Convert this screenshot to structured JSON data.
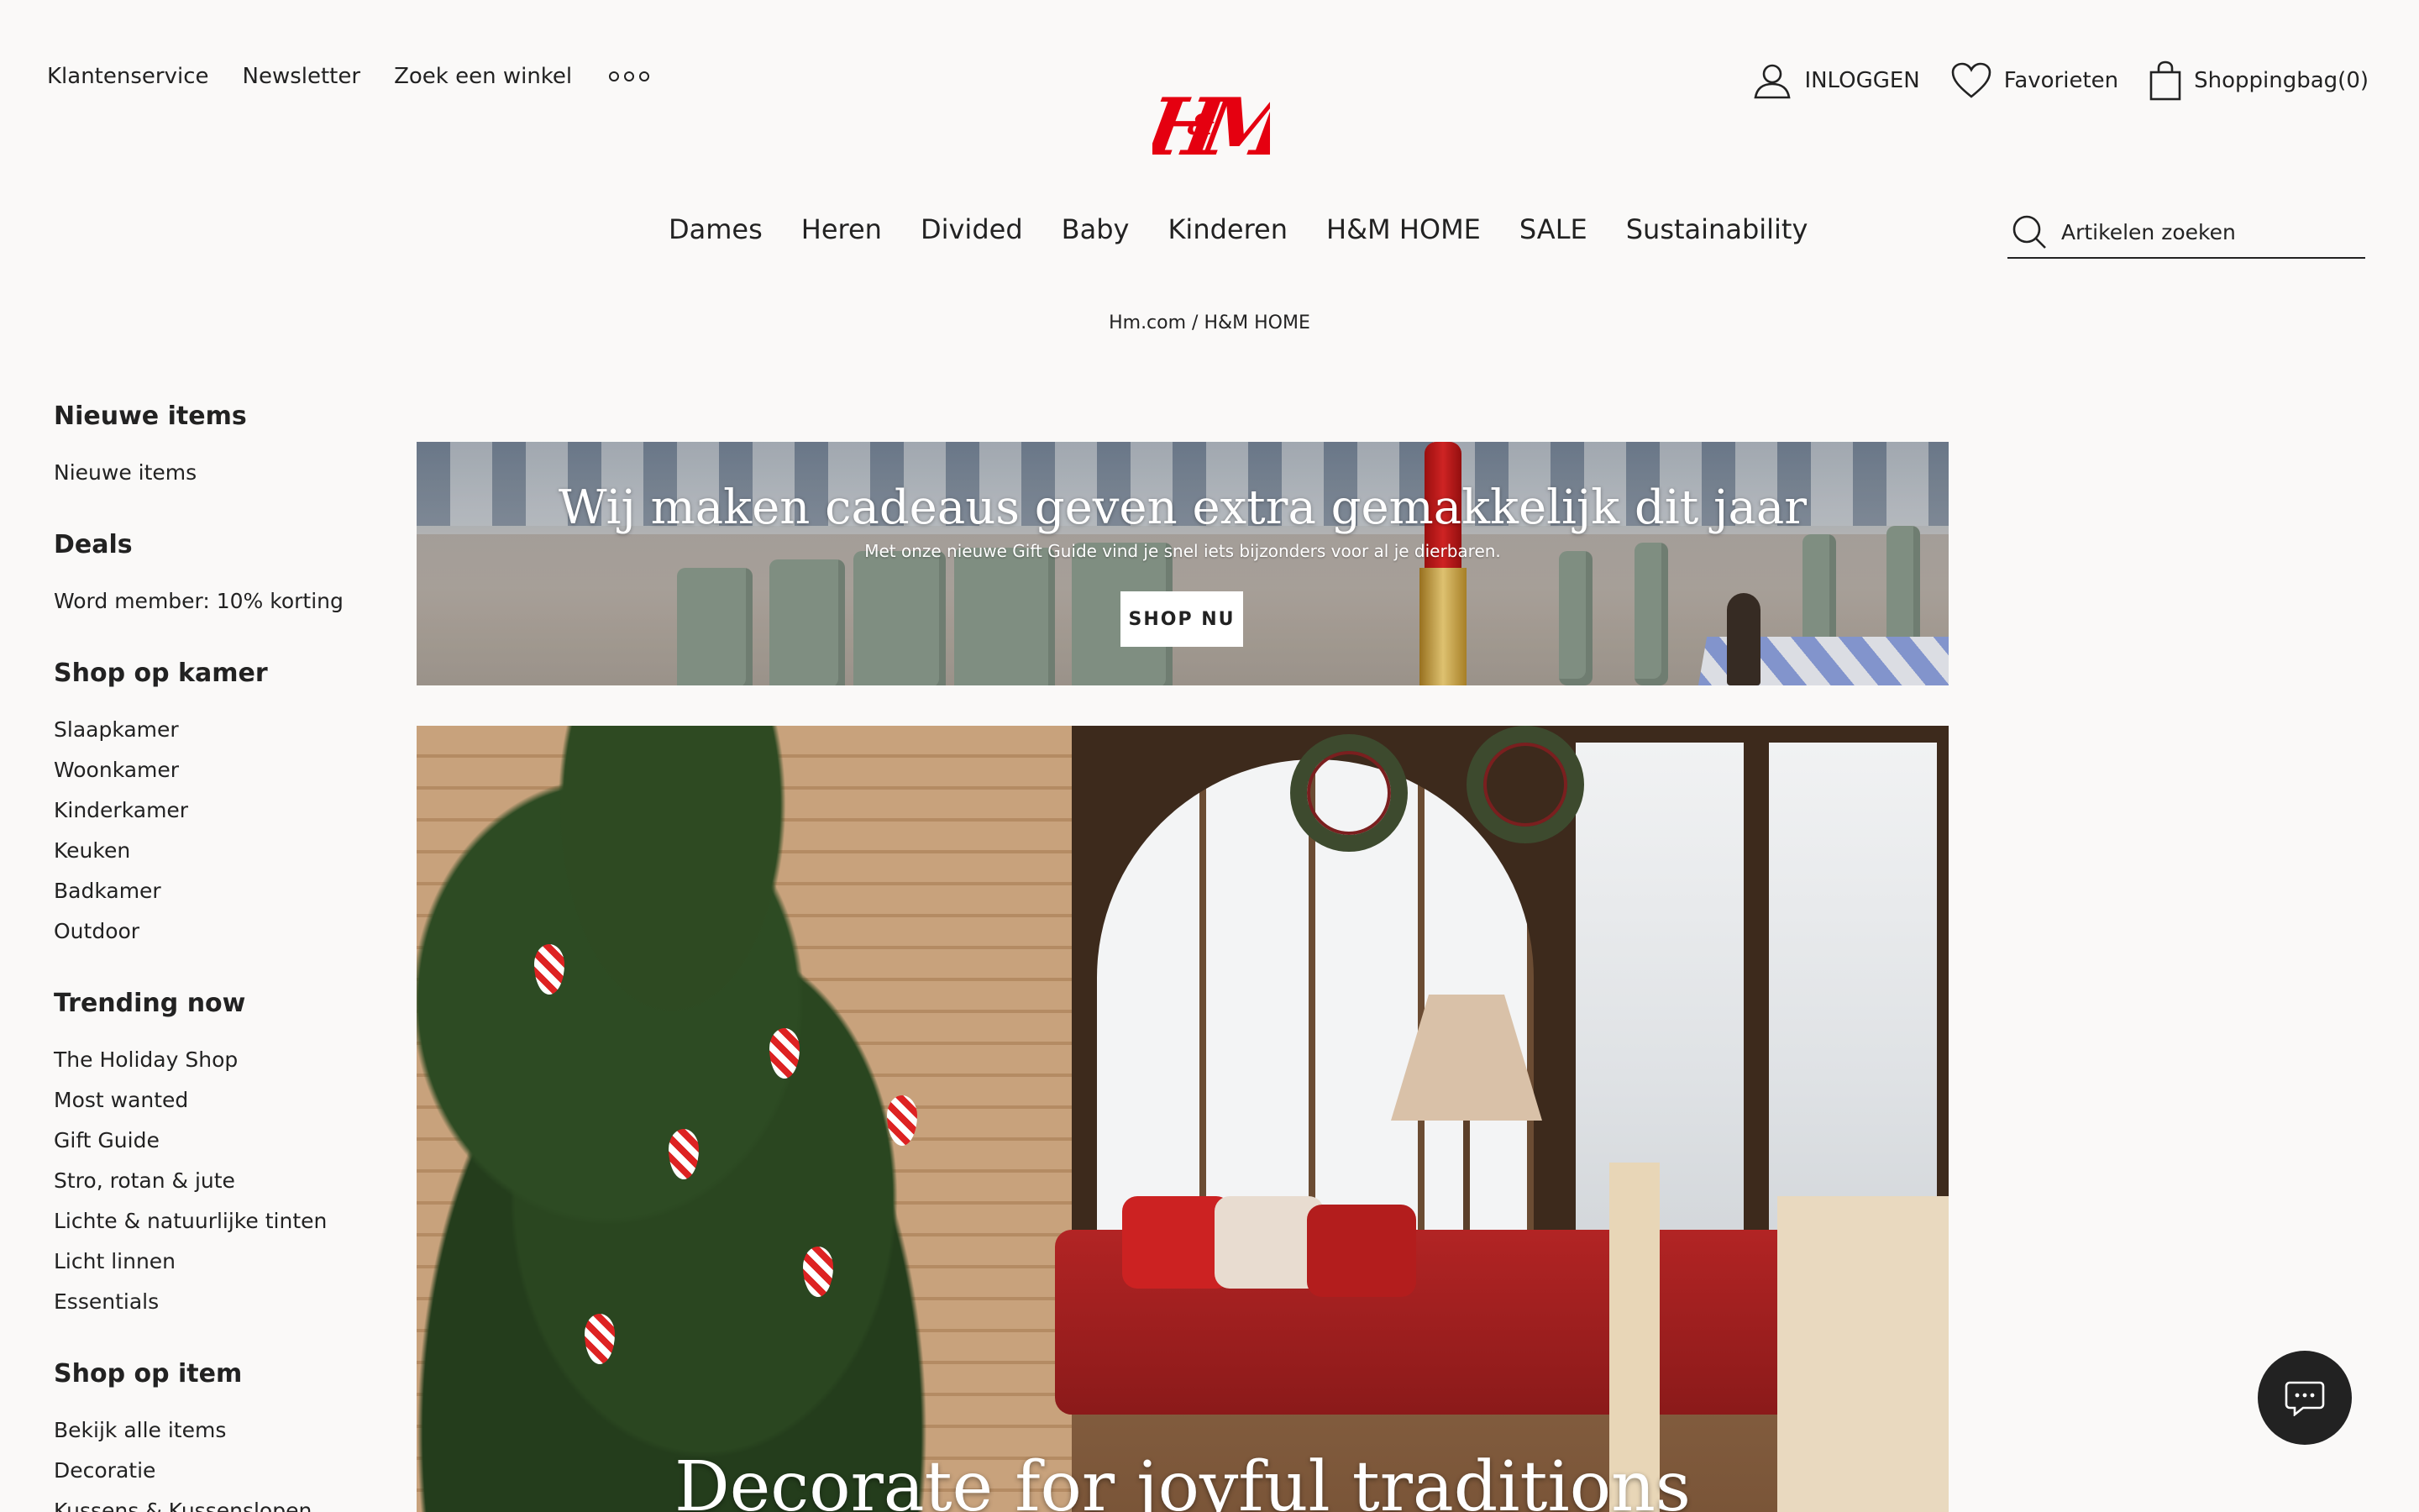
{
  "utility_nav": {
    "links": [
      "Klantenservice",
      "Newsletter",
      "Zoek een winkel"
    ],
    "more_icon": "more-dots-icon"
  },
  "brand": {
    "logo_text": "H&M",
    "color": "#e50010"
  },
  "account": {
    "login": "INLOGGEN",
    "favorites": "Favorieten",
    "bag": "Shoppingbag(0)"
  },
  "main_nav": [
    "Dames",
    "Heren",
    "Divided",
    "Baby",
    "Kinderen",
    "H&M HOME",
    "SALE",
    "Sustainability"
  ],
  "search": {
    "placeholder": "Artikelen zoeken"
  },
  "breadcrumb": {
    "home": "Hm.com",
    "separator": "/",
    "current": "H&M HOME"
  },
  "sidebar": [
    {
      "heading": "Nieuwe items",
      "items": [
        "Nieuwe items"
      ]
    },
    {
      "heading": "Deals",
      "items": [
        "Word member: 10% korting"
      ]
    },
    {
      "heading": "Shop op kamer",
      "items": [
        "Slaapkamer",
        "Woonkamer",
        "Kinderkamer",
        "Keuken",
        "Badkamer",
        "Outdoor"
      ]
    },
    {
      "heading": "Trending now",
      "items": [
        "The Holiday Shop",
        "Most wanted",
        "Gift Guide",
        "Stro, rotan & jute",
        "Lichte & natuurlijke tinten",
        "Licht linnen",
        "Essentials"
      ]
    },
    {
      "heading": "Shop op item",
      "items": [
        "Bekijk alle items",
        "Decoratie",
        "Kussens & Kussenslopen"
      ]
    }
  ],
  "banner_gift": {
    "title": "Wij maken cadeaus geven extra gemakkelijk dit jaar",
    "subtitle": "Met onze nieuwe Gift Guide vind je snel iets bijzonders voor al je dierbaren.",
    "cta": "SHOP NU"
  },
  "banner_holiday": {
    "title": "Decorate for joyful traditions"
  },
  "chat": {
    "icon": "chat-icon"
  }
}
